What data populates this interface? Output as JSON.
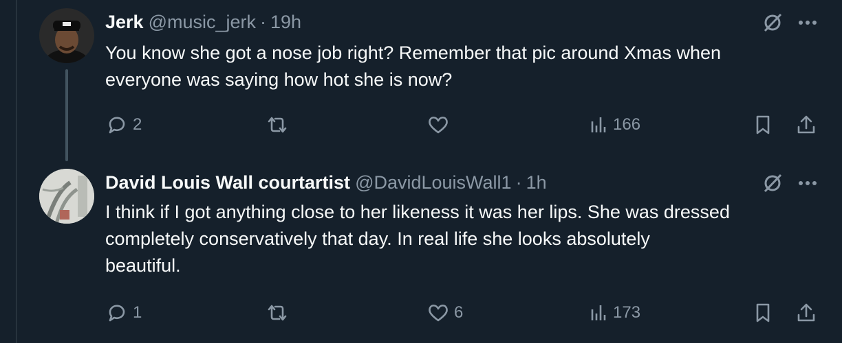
{
  "tweets": [
    {
      "name": "Jerk",
      "handle": "@music_jerk",
      "separator": "·",
      "time": "19h",
      "text": "You know she got a nose job right? Remember that pic around Xmas when\neveryone was saying how hot she is now?",
      "replies": "2",
      "retweets": "",
      "likes": "",
      "views": "166"
    },
    {
      "name": "David Louis Wall courtartist",
      "handle": "@DavidLouisWall1",
      "separator": "·",
      "time": "1h",
      "text": "I think if I got anything close to her likeness it was her lips. She was dressed\ncompletely conservatively that day.  In real life she looks absolutely\nbeautiful.",
      "replies": "1",
      "retweets": "",
      "likes": "6",
      "views": "173"
    }
  ],
  "icons": {
    "grok": "grok-icon",
    "more": "more-icon",
    "reply": "reply-icon",
    "retweet": "retweet-icon",
    "like": "heart-icon",
    "views": "views-icon",
    "bookmark": "bookmark-icon",
    "share": "share-icon"
  },
  "colors": {
    "background": "#15202b",
    "text": "#f7f9f9",
    "secondary": "#8b98a5",
    "thread_line": "#42535f"
  }
}
